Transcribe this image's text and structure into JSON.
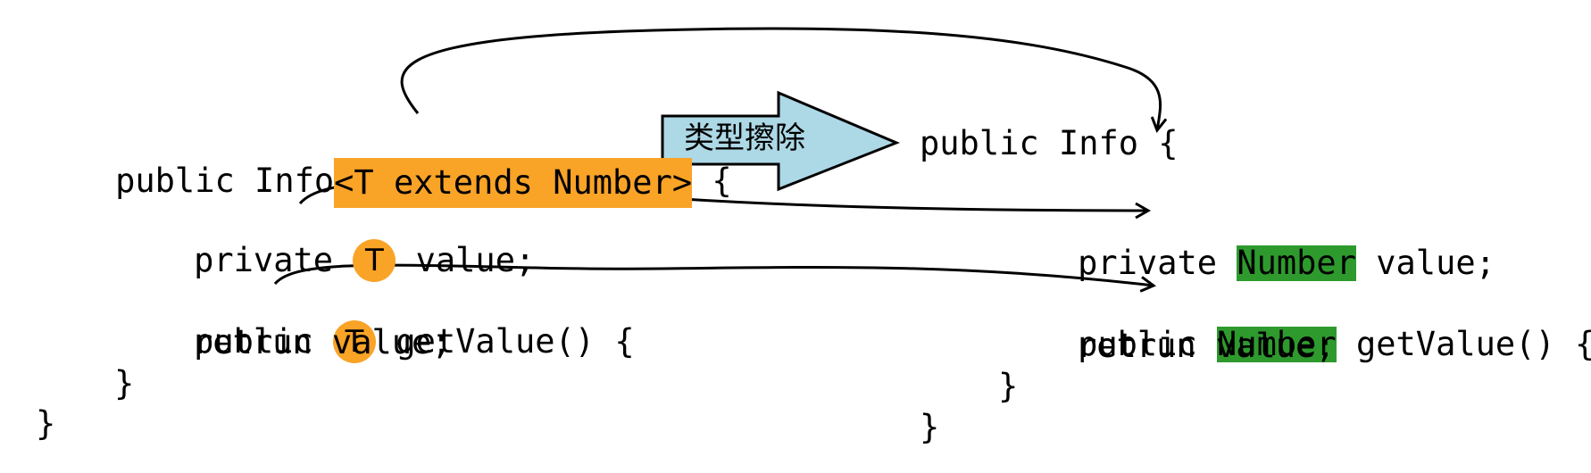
{
  "left_code": {
    "line1": {
      "prefix": "public Info",
      "highlight": "<T extends Number>",
      "suffix": " {"
    },
    "line2": {
      "prefix": "private ",
      "marker": "T",
      "suffix": " value;"
    },
    "line3": {
      "prefix": "public ",
      "marker": "T",
      "suffix": " getValue() {"
    },
    "line4": "retrun value;",
    "line5": "}",
    "line6": "}"
  },
  "arrow": {
    "label": "类型擦除",
    "fill": "#add8e6"
  },
  "right_code": {
    "line1": "public Info {",
    "line2": {
      "prefix": "private ",
      "highlight": "Number",
      "suffix": " value;"
    },
    "line3": {
      "prefix": "public ",
      "highlight": "Number",
      "suffix": " getValue() {"
    },
    "line4": "retrun value;",
    "line5": "}",
    "line6": "}"
  },
  "colors": {
    "orange": "#f9a327",
    "green": "#2e9a2e",
    "arrow_fill": "#add8e6",
    "stroke": "#000000"
  }
}
